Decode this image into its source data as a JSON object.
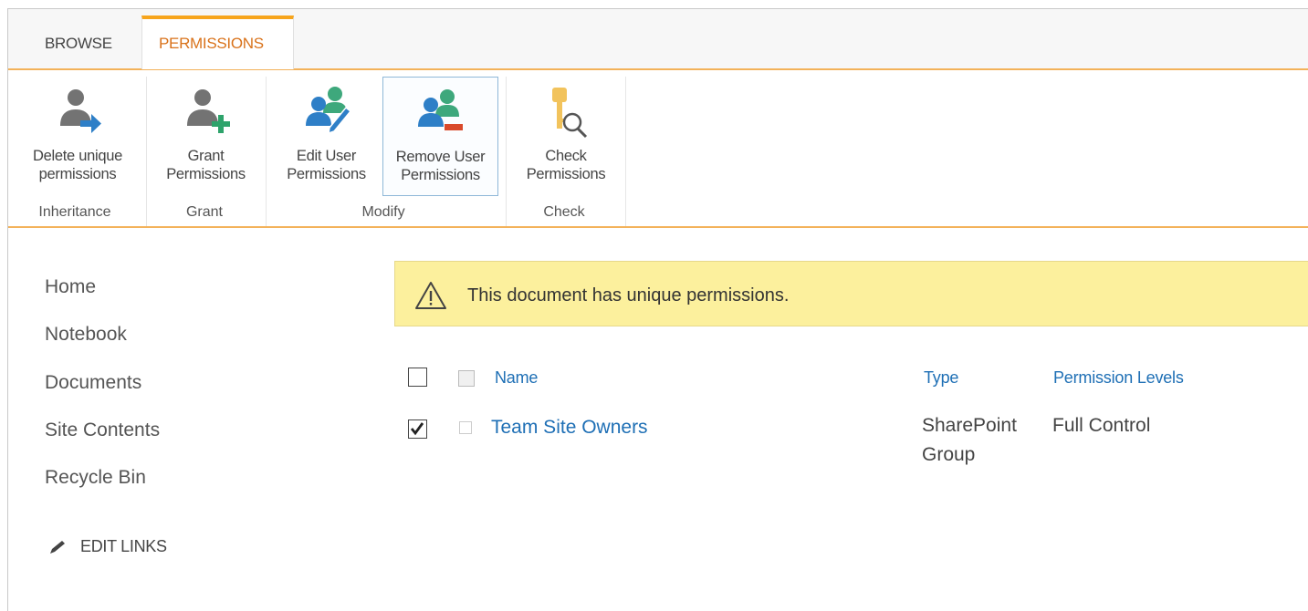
{
  "tabs": {
    "browse": "BROWSE",
    "permissions": "PERMISSIONS"
  },
  "ribbon": {
    "buttons": [
      {
        "line1": "Delete unique",
        "line2": "permissions",
        "icon": "person-arrow-icon"
      },
      {
        "line1": "Grant",
        "line2": "Permissions",
        "icon": "person-plus-icon"
      },
      {
        "line1": "Edit User",
        "line2": "Permissions",
        "icon": "users-edit-icon"
      },
      {
        "line1": "Remove User",
        "line2": "Permissions",
        "icon": "users-remove-icon"
      },
      {
        "line1": "Check",
        "line2": "Permissions",
        "icon": "key-search-icon"
      }
    ],
    "groups": [
      "Inheritance",
      "Grant",
      "Modify",
      "Check"
    ]
  },
  "nav": {
    "items": [
      "Home",
      "Notebook",
      "Documents",
      "Site Contents",
      "Recycle Bin"
    ],
    "edit_links": "EDIT LINKS"
  },
  "banner": {
    "message": "This document has unique permissions."
  },
  "table": {
    "headers": {
      "name": "Name",
      "type": "Type",
      "levels": "Permission Levels"
    },
    "rows": [
      {
        "name": "Team Site Owners",
        "type_line1": "SharePoint",
        "type_line2": "Group",
        "levels": "Full Control",
        "checked": true
      }
    ]
  },
  "colors": {
    "accent": "#f7a51c",
    "link": "#1e6fb5",
    "banner": "#fcf09d"
  }
}
